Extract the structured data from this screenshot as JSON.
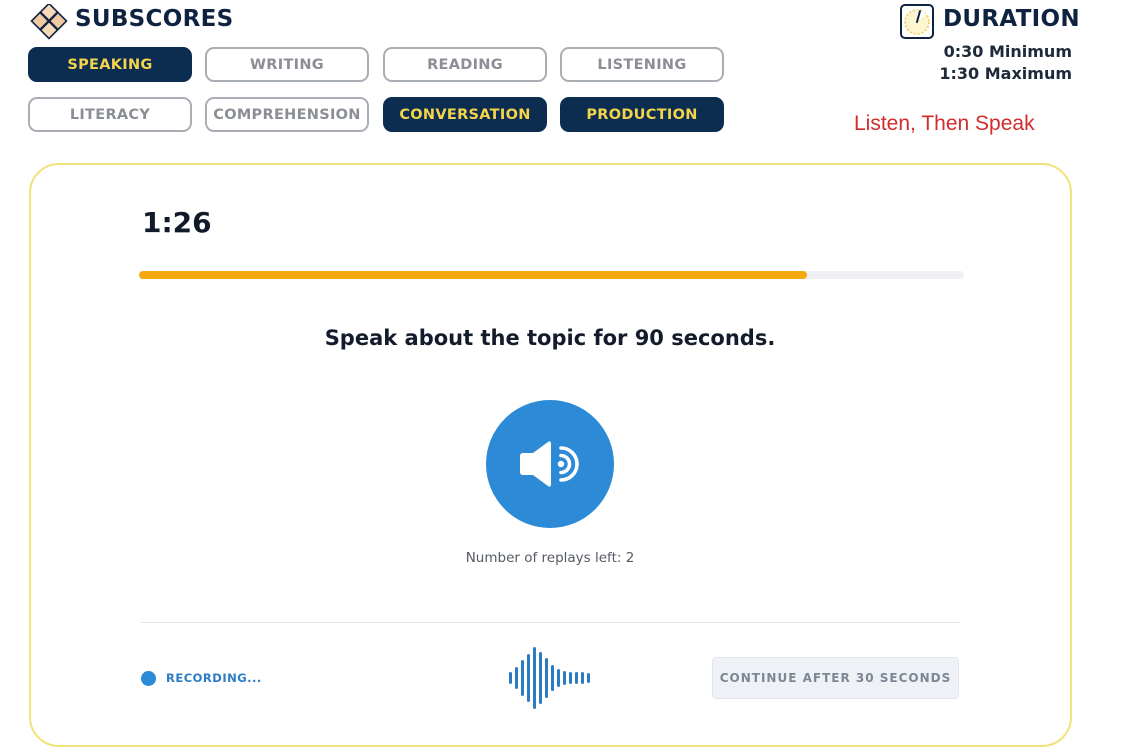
{
  "header": {
    "subscores_title": "SUBSCORES",
    "duration_title": "DURATION",
    "duration_min": "0:30 Minimum",
    "duration_max": "1:30 Maximum",
    "task_type": "Listen, Then Speak"
  },
  "subscores": [
    {
      "label": "SPEAKING",
      "active": true
    },
    {
      "label": "WRITING",
      "active": false
    },
    {
      "label": "READING",
      "active": false
    },
    {
      "label": "LISTENING",
      "active": false
    },
    {
      "label": "LITERACY",
      "active": false
    },
    {
      "label": "COMPREHENSION",
      "active": false
    },
    {
      "label": "CONVERSATION",
      "active": true
    },
    {
      "label": "PRODUCTION",
      "active": true
    }
  ],
  "task": {
    "time_left": "1:26",
    "progress_fraction": 0.81,
    "instruction": "Speak about the topic for 90 seconds.",
    "replays_text": "Number of replays left: 2",
    "recording_label": "RECORDING...",
    "continue_label": "CONTINUE AFTER 30 SECONDS"
  },
  "colors": {
    "navy": "#0c2d4f",
    "active_text": "#f4d44d",
    "accent_blue": "#2c8ad6",
    "progress": "#f6a90f",
    "card_border": "#f2e27c",
    "task_type_red": "#d02c2c"
  },
  "icons": {
    "logo": "diamond-grid-icon",
    "timer": "timer-icon",
    "speaker": "speaker-icon",
    "recording": "recording-dot-icon",
    "waveform": "waveform-icon"
  }
}
